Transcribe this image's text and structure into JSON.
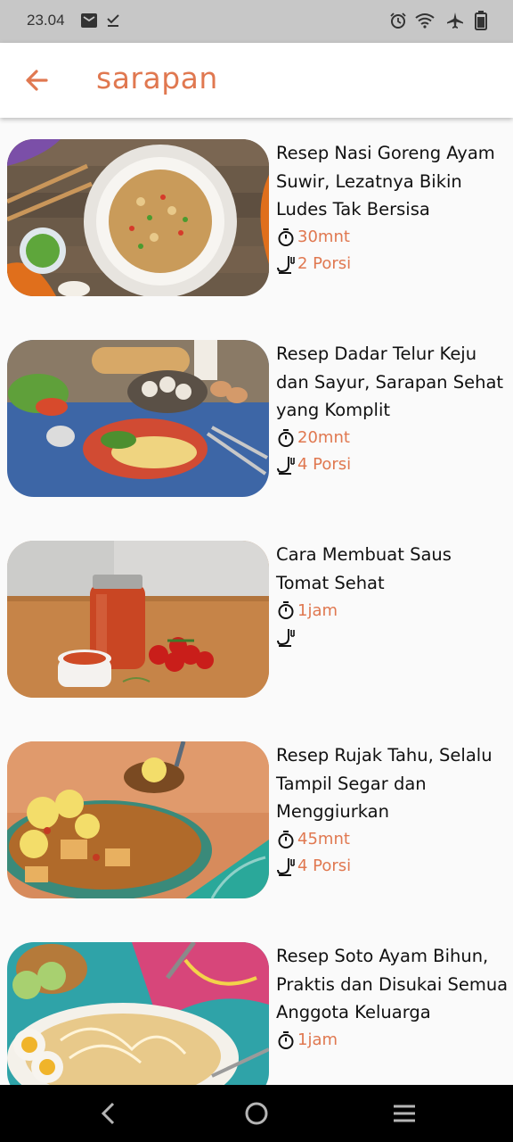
{
  "status": {
    "time": "23.04"
  },
  "appbar": {
    "title": "sarapan"
  },
  "recipes": [
    {
      "title": "Resep Nasi Goreng Ayam Suwir, Lezatnya Bikin Ludes Tak Bersisa",
      "time": "30mnt",
      "portion": "2 Porsi"
    },
    {
      "title": "Resep Dadar Telur Keju dan Sayur, Sarapan Sehat yang Komplit",
      "time": "20mnt",
      "portion": "4 Porsi"
    },
    {
      "title": "Cara Membuat Saus Tomat Sehat",
      "time": "1jam",
      "portion": ""
    },
    {
      "title": "Resep Rujak Tahu, Selalu Tampil Segar dan Menggiurkan",
      "time": "45mnt",
      "portion": "4 Porsi"
    },
    {
      "title": "Resep Soto Ayam Bihun, Praktis dan Disukai Semua Anggota Keluarga",
      "time": "1jam",
      "portion": ""
    }
  ],
  "colors": {
    "accent": "#e07850",
    "statusbar": "#c7c7c7",
    "navbar": "#000000"
  },
  "icons": {
    "time": "timer-icon",
    "portion": "serving-icon"
  }
}
